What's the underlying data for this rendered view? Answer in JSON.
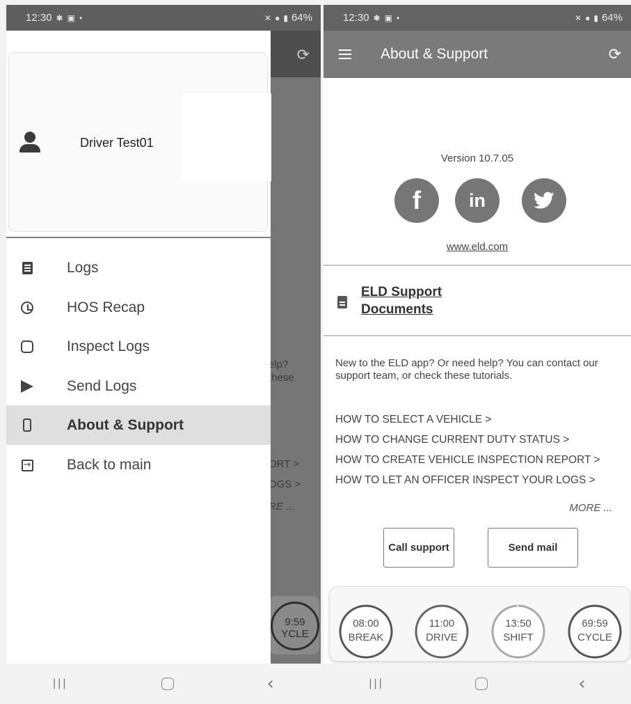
{
  "status_bar": {
    "time": "12:30",
    "battery": "64%"
  },
  "left_screen": {
    "underlying": {
      "snippets": [
        "elp?",
        "these",
        "ORT >",
        "OGS >",
        "RE ..."
      ],
      "gauge_text": [
        "9:59",
        "YCLE"
      ]
    },
    "drawer": {
      "driver_name": "Driver Test01",
      "menu": [
        {
          "label": "Logs",
          "icon": "logs-icon"
        },
        {
          "label": "HOS Recap",
          "icon": "alarm-clock-icon"
        },
        {
          "label": "Inspect Logs",
          "icon": "inspect-icon"
        },
        {
          "label": "Send Logs",
          "icon": "send-icon"
        },
        {
          "label": "About & Support",
          "icon": "phone-icon",
          "active": true
        },
        {
          "label": "Back to main",
          "icon": "exit-icon"
        }
      ]
    }
  },
  "right_screen": {
    "toolbar": {
      "title": "About & Support"
    },
    "version": "Version 10.7.05",
    "social": {
      "facebook": "f",
      "linkedin": "in"
    },
    "website": "www.eld.com",
    "support_docs": "ELD Support Documents",
    "help_text": "New to the ELD app? Or need help? You can contact our support team, or check these tutorials.",
    "tutorials": [
      "HOW TO SELECT A VEHICLE >",
      "HOW TO CHANGE CURRENT DUTY STATUS >",
      "HOW TO CREATE VEHICLE INSPECTION REPORT >",
      "HOW TO LET AN OFFICER INSPECT YOUR LOGS >"
    ],
    "more": "MORE ...",
    "buttons": {
      "call": "Call support",
      "mail": "Send mail"
    },
    "gauges": [
      {
        "time": "08:00",
        "label": "BREAK",
        "fraction": 1.0
      },
      {
        "time": "11:00",
        "label": "DRIVE",
        "fraction": 1.0
      },
      {
        "time": "13:50",
        "label": "SHIFT",
        "fraction": 0.99
      },
      {
        "time": "69:59",
        "label": "CYCLE",
        "fraction": 1.0
      }
    ]
  }
}
